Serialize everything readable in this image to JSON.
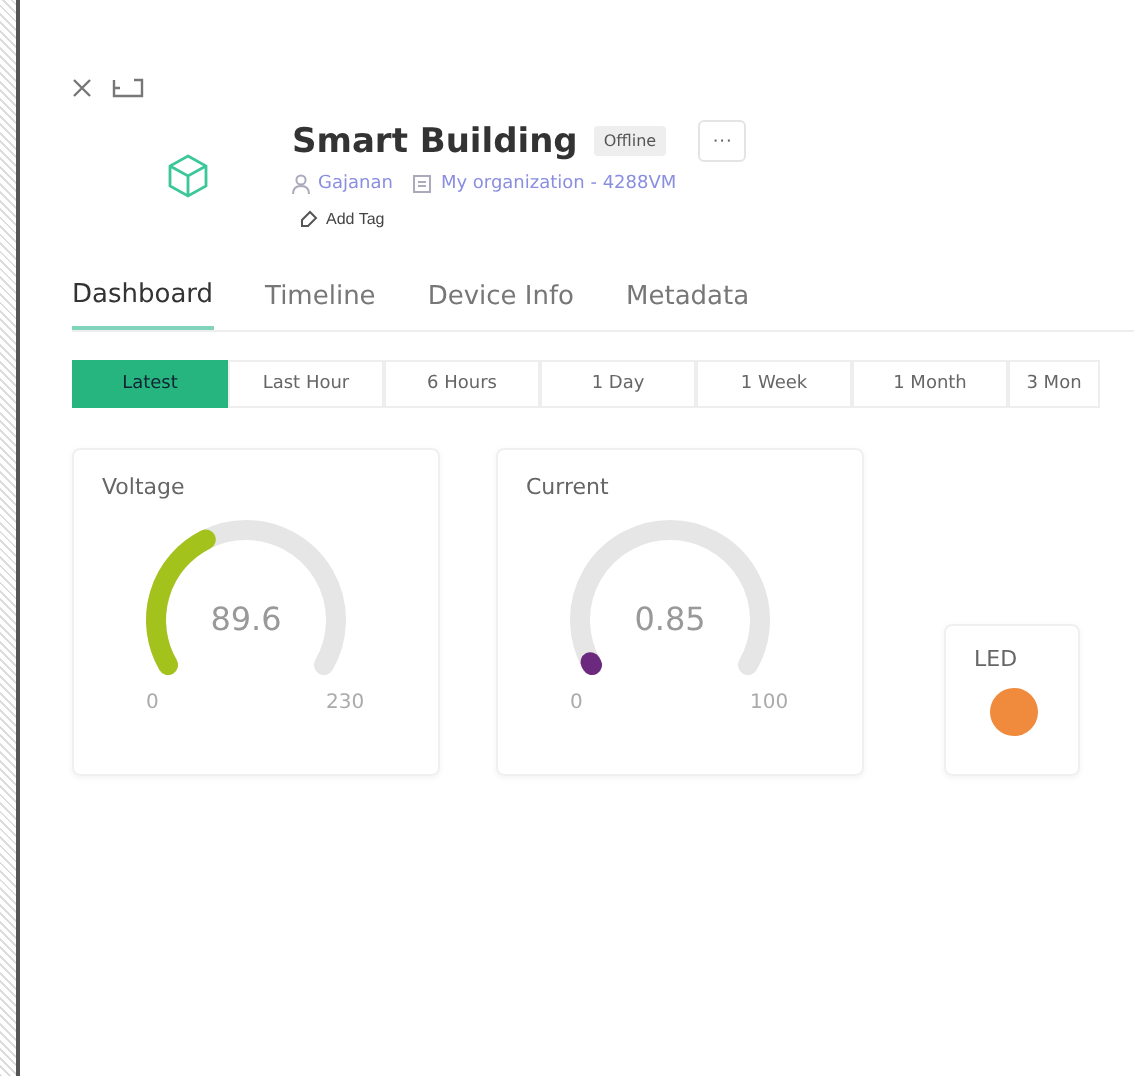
{
  "device": {
    "name": "Smart Building",
    "status": "Offline",
    "more": "···",
    "owner": "Gajanan",
    "organization": "My organization - 4288VM",
    "add_tag": "Add Tag"
  },
  "tabs": [
    {
      "label": "Dashboard",
      "selected": true
    },
    {
      "label": "Timeline",
      "selected": false
    },
    {
      "label": "Device Info",
      "selected": false
    },
    {
      "label": "Metadata",
      "selected": false
    }
  ],
  "ranges": [
    {
      "label": "Latest",
      "selected": true
    },
    {
      "label": "Last Hour",
      "selected": false
    },
    {
      "label": "6 Hours",
      "selected": false
    },
    {
      "label": "1 Day",
      "selected": false
    },
    {
      "label": "1 Week",
      "selected": false
    },
    {
      "label": "1 Month",
      "selected": false
    },
    {
      "label": "3 Mon",
      "selected": false
    }
  ],
  "widgets": [
    {
      "kind": "gauge",
      "title": "Voltage",
      "value": "89.6",
      "min": "0",
      "max": "230",
      "color": "#a4c21c"
    },
    {
      "kind": "gauge",
      "title": "Current",
      "value": "0.85",
      "min": "0",
      "max": "100",
      "color": "#6b2a7e"
    },
    {
      "kind": "led",
      "title": "LED",
      "color": "#f08a3c"
    }
  ]
}
